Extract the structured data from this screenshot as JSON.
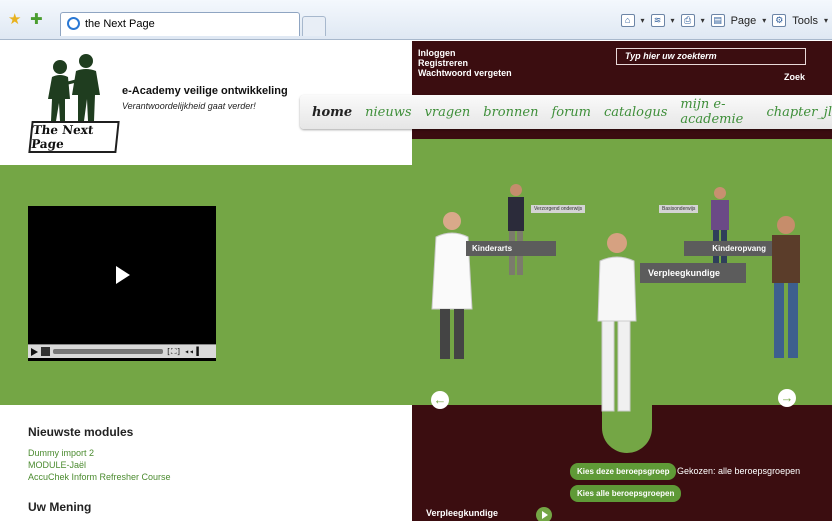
{
  "browser": {
    "tab_title": "the Next Page",
    "commands": {
      "page": "Page",
      "tools": "Tools"
    }
  },
  "header": {
    "logo_text": "The Next Page",
    "tagline_1": "e-Academy veilige ontwikkeling",
    "tagline_2": "Verantwoordelijkheid gaat verder!",
    "account_links": [
      "Inloggen",
      "Registreren",
      "Wachtwoord vergeten"
    ],
    "search_placeholder": "Typ hier uw zoekterm",
    "search_button": "Zoek",
    "nav": [
      "home",
      "nieuws",
      "vragen",
      "bronnen",
      "forum",
      "catalogus",
      "mijn e-academie",
      "chapter_jl"
    ]
  },
  "stage": {
    "professions": [
      {
        "label": "Kinderarts"
      },
      {
        "label": "Verpleegkundige"
      },
      {
        "label": "Kinderopvang"
      }
    ],
    "tiny_tags": [
      "Verzorgend onderwijs",
      "Basisonderwijs"
    ]
  },
  "panel": {
    "choose_button": "Kies deze beroepsgroep",
    "choose_all_button": "Kies alle beroepsgroepen",
    "selected_text": "Gekozen: alle beroepsgroepen",
    "current_label": "Verpleegkundige"
  },
  "sidebar": {
    "modules_title": "Nieuwste modules",
    "modules": [
      "Dummy import 2",
      "MODULE-Jaël",
      "AccuChek Inform Refresher Course"
    ],
    "opinion_title": "Uw Mening"
  },
  "colors": {
    "green": "#74a645",
    "maroon": "#3b0d10",
    "nav_green": "#3f8f3a"
  }
}
